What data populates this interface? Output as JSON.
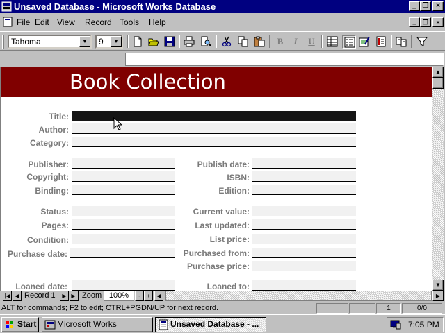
{
  "window": {
    "title": "Unsaved Database - Microsoft Works Database",
    "controls": [
      "minimize",
      "maximize",
      "close"
    ]
  },
  "menu": {
    "items": [
      {
        "label": "File",
        "key": "F",
        "rest": "ile"
      },
      {
        "label": "Edit",
        "key": "E",
        "rest": "dit"
      },
      {
        "label": "View",
        "key": "V",
        "rest": "iew"
      },
      {
        "label": "Record",
        "key": "R",
        "rest": "ecord"
      },
      {
        "label": "Tools",
        "key": "T",
        "rest": "ools"
      },
      {
        "label": "Help",
        "key": "H",
        "rest": "elp"
      }
    ]
  },
  "toolbar": {
    "font_name": "Tahoma",
    "font_size": "9",
    "buttons": [
      "new",
      "open",
      "save",
      "print",
      "print-preview",
      "cut",
      "copy",
      "paste",
      "bold",
      "italic",
      "underline",
      "list-view",
      "form-view",
      "form-design",
      "report-view",
      "address-book",
      "filter"
    ],
    "bold_glyph": "B",
    "italic_glyph": "I",
    "underline_glyph": "U"
  },
  "form": {
    "title": "Book Collection",
    "fields_left": [
      {
        "label": "Title:"
      },
      {
        "label": "Author:"
      },
      {
        "label": "Category:"
      },
      {
        "label": "Publisher:"
      },
      {
        "label": "Copyright:"
      },
      {
        "label": "Binding:"
      },
      {
        "label": "Status:"
      },
      {
        "label": "Pages:"
      },
      {
        "label": "Condition:"
      },
      {
        "label": "Purchase date:"
      },
      {
        "label": "Loaned date:"
      }
    ],
    "fields_right": [
      {
        "label": "Publish date:"
      },
      {
        "label": "ISBN:"
      },
      {
        "label": "Edition:"
      },
      {
        "label": "Current value:"
      },
      {
        "label": "Last updated:"
      },
      {
        "label": "List price:"
      },
      {
        "label": "Purchased from:"
      },
      {
        "label": "Purchase price:"
      },
      {
        "label": "Loaned to:"
      }
    ]
  },
  "navigation": {
    "record_label": "Record 1",
    "zoom_label": "Zoom",
    "zoom_value": "100%",
    "minus": "-",
    "plus": "+"
  },
  "status": {
    "hint": "ALT for commands; F2 to edit; CTRL+PGDN/UP for next record.",
    "record_number": "1",
    "record_count": "0/0"
  },
  "taskbar": {
    "start_label": "Start",
    "tasks": [
      {
        "label": "Microsoft Works",
        "active": false
      },
      {
        "label": "Unsaved Database - ...",
        "active": true
      }
    ],
    "clock": "7:05 PM"
  },
  "colors": {
    "title_bar": "#000080",
    "banner": "#800000",
    "label_gray": "#7a7a7a",
    "face": "#c0c0c0"
  }
}
